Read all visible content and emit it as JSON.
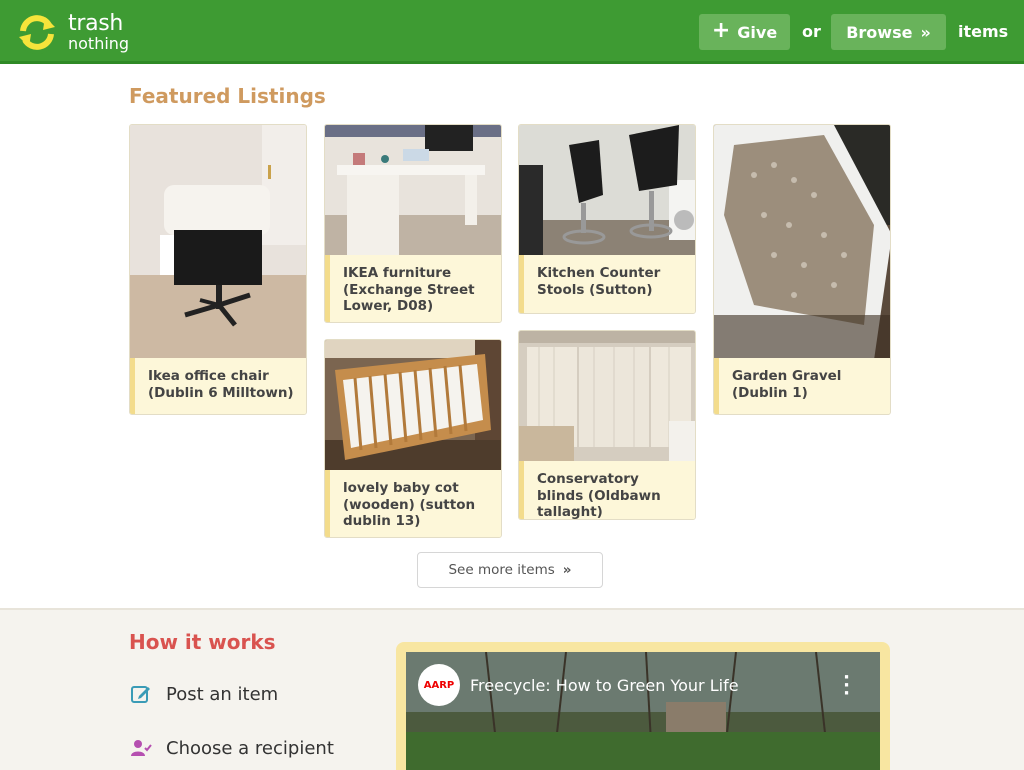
{
  "header": {
    "logo_line1": "trash",
    "logo_line2": "nothing",
    "give_label": "Give",
    "give_glyph": "+",
    "or_text": "or",
    "browse_label": "Browse",
    "browse_glyph": "»",
    "items_text": "items",
    "bg_color": "#3e9b33",
    "button_color": "#69b35b"
  },
  "featured": {
    "title": "Featured Listings",
    "listings": [
      {
        "title": "Ikea office chair (Dublin 6 Milltown)"
      },
      {
        "title": "IKEA furniture (Exchange Street Lower, D08)"
      },
      {
        "title": "Kitchen Counter Stools (Sutton)"
      },
      {
        "title": "Garden Gravel (Dublin 1)"
      },
      {
        "title": "lovely baby cot (wooden) (sutton dublin 13)"
      },
      {
        "title": "Conservatory blinds (Oldbawn tallaght)"
      }
    ],
    "see_more_label": "See more items",
    "see_more_glyph": "»"
  },
  "how": {
    "title": "How it works",
    "steps": [
      {
        "label": "Post an item",
        "icon": "edit-icon"
      },
      {
        "label": "Choose a recipient",
        "icon": "user-check-icon"
      }
    ]
  },
  "video": {
    "channel_badge": "AARP",
    "title": "Freecycle: How to Green Your Life"
  }
}
